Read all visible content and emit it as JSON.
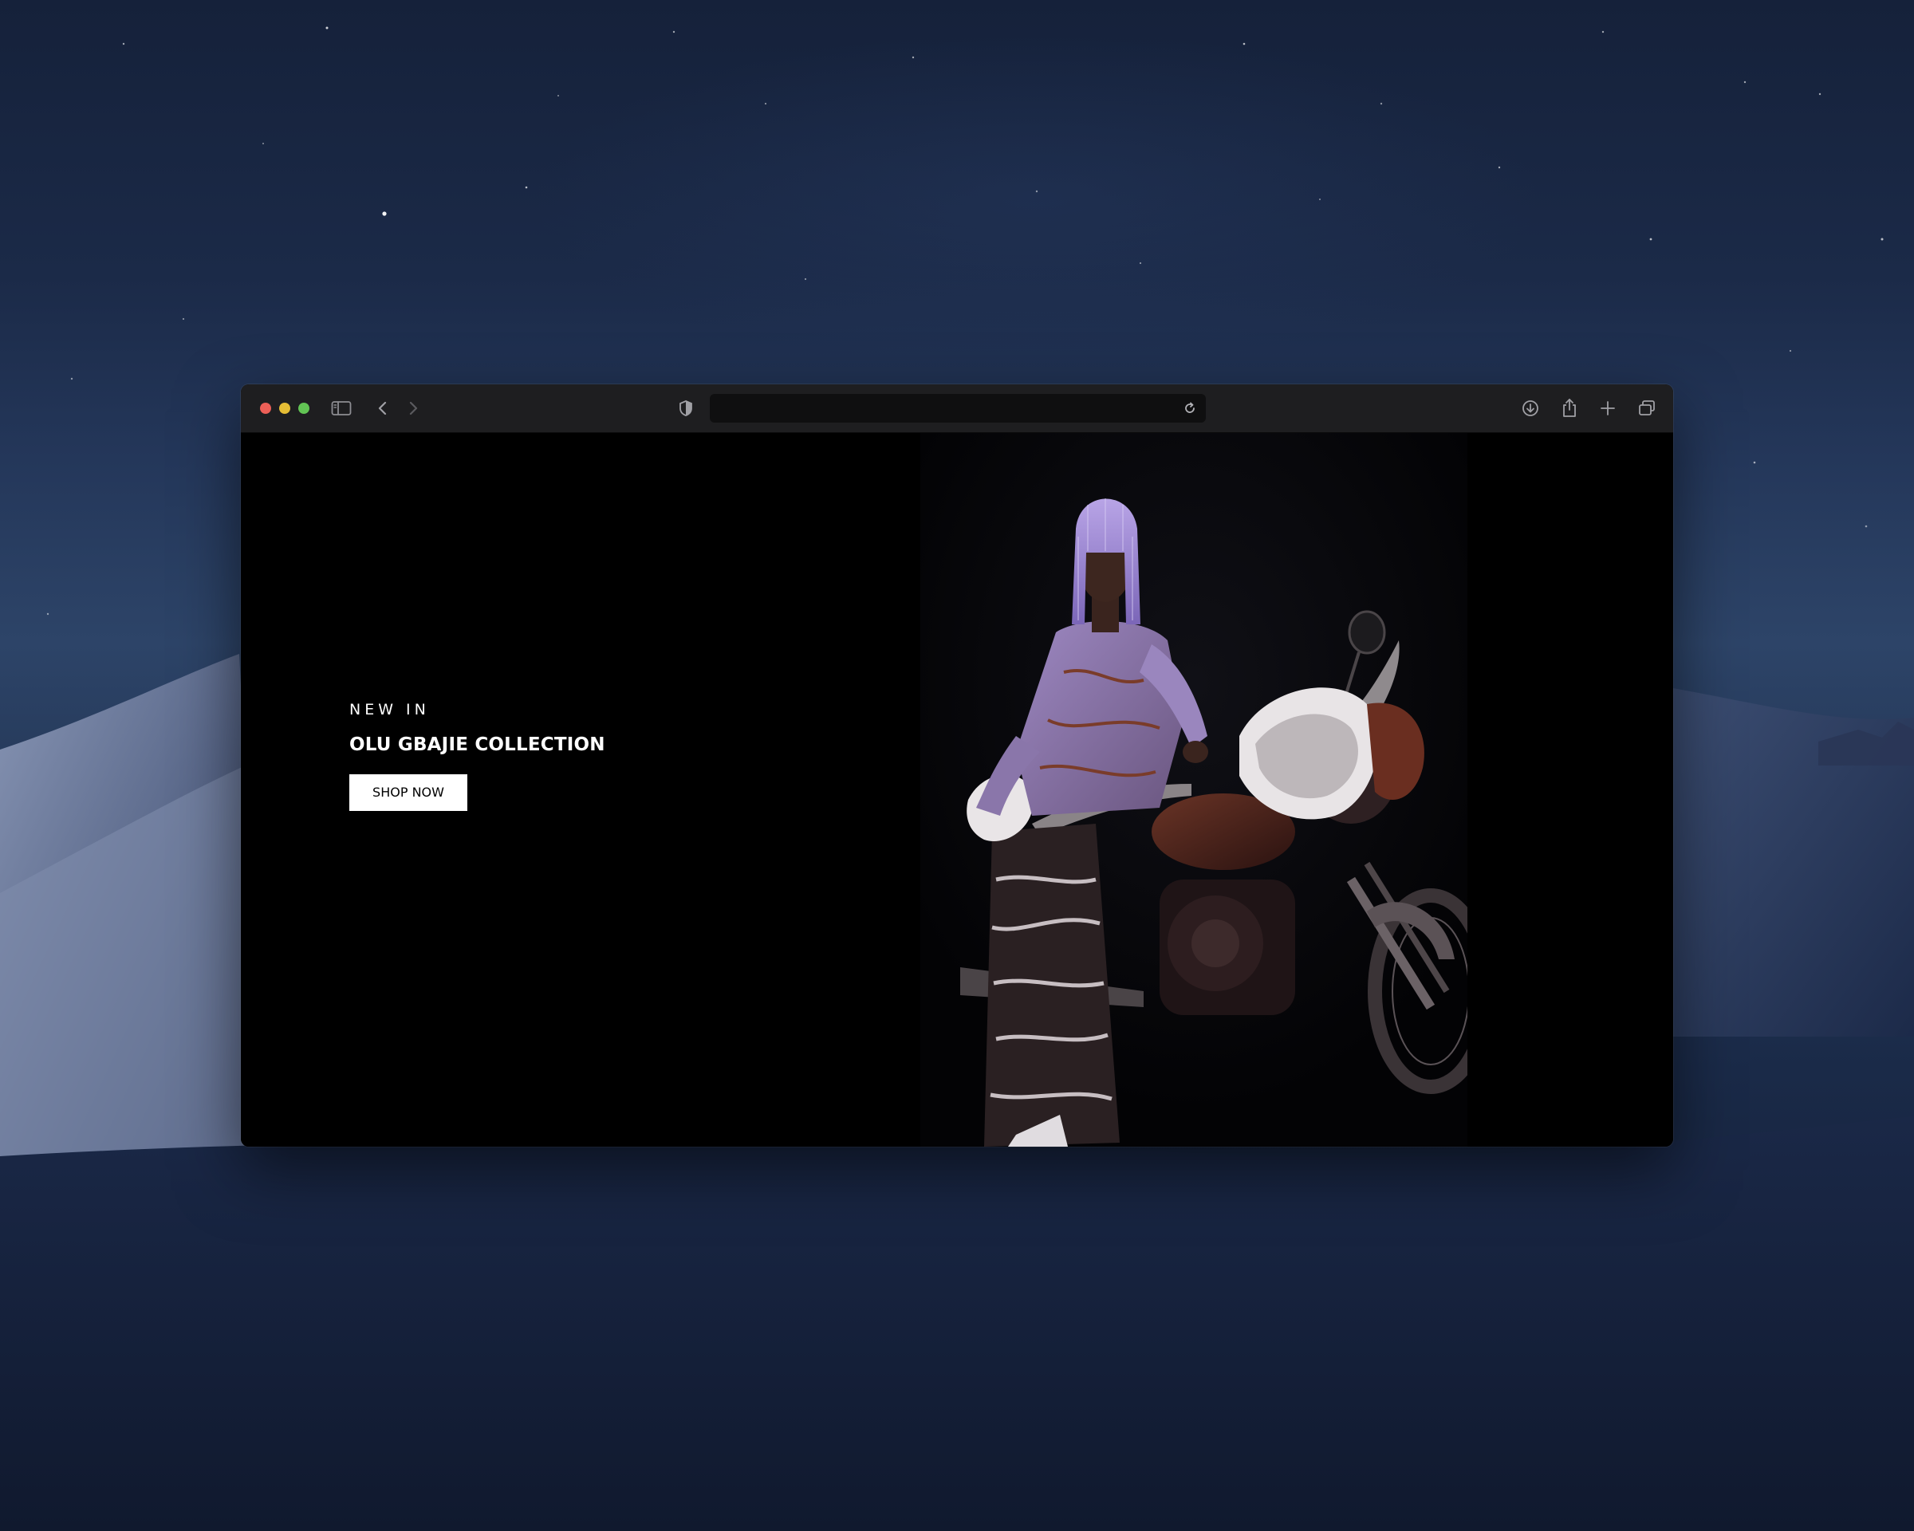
{
  "browser": {
    "address_text": ""
  },
  "hero": {
    "eyebrow": "NEW IN",
    "headline": "OLU GBAJIE COLLECTION",
    "cta_label": "SHOP NOW"
  },
  "colors": {
    "page_background": "#000000",
    "toolbar_background": "#1e1e20",
    "traffic_close": "#ec5f57",
    "traffic_minimize": "#e5bd35",
    "traffic_maximize": "#62c454",
    "cta_background": "#ffffff",
    "cta_text": "#000000"
  },
  "icons": [
    "sidebar-icon",
    "back-icon",
    "forward-icon",
    "shield-icon",
    "reload-icon",
    "download-icon",
    "share-icon",
    "new-tab-icon",
    "tabs-overview-icon"
  ]
}
